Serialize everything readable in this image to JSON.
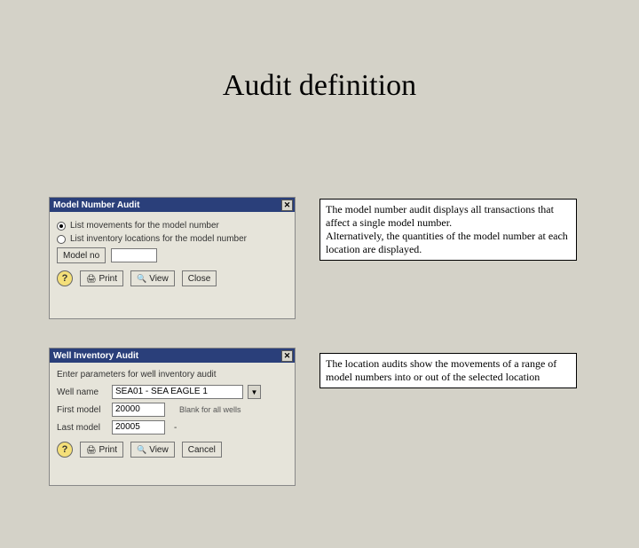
{
  "slide": {
    "title": "Audit definition"
  },
  "dialog1": {
    "title": "Model Number Audit",
    "close": "✕",
    "radio1": "List movements for the model number",
    "radio2": "List inventory locations for the model number",
    "model_label": "Model no",
    "model_value": "",
    "help": "?",
    "print_icon": "🖨",
    "print": "Print",
    "view_icon": "🔍",
    "view": "View",
    "close_btn": "Close"
  },
  "dialog2": {
    "title": "Well Inventory Audit",
    "close": "✕",
    "intro": "Enter parameters for well inventory audit",
    "well_label": "Well name",
    "well_value": "SEA01 - SEA EAGLE 1",
    "dd": "▼",
    "blank_note": "Blank for all wells",
    "first_label": "First model",
    "first_value": "20000",
    "last_label": "Last model",
    "last_value": "20005",
    "dash": "-",
    "help": "?",
    "print_icon": "🖨",
    "print": "Print",
    "view_icon": "🔍",
    "view": "View",
    "cancel": "Cancel"
  },
  "annot1": {
    "l1": "The model number audit displays all transactions that affect a single model number.",
    "l2": "Alternatively, the quantities of the model number at each location are displayed."
  },
  "annot2": {
    "text": "The location audits show the movements of a range of model numbers into or out of the selected location"
  }
}
